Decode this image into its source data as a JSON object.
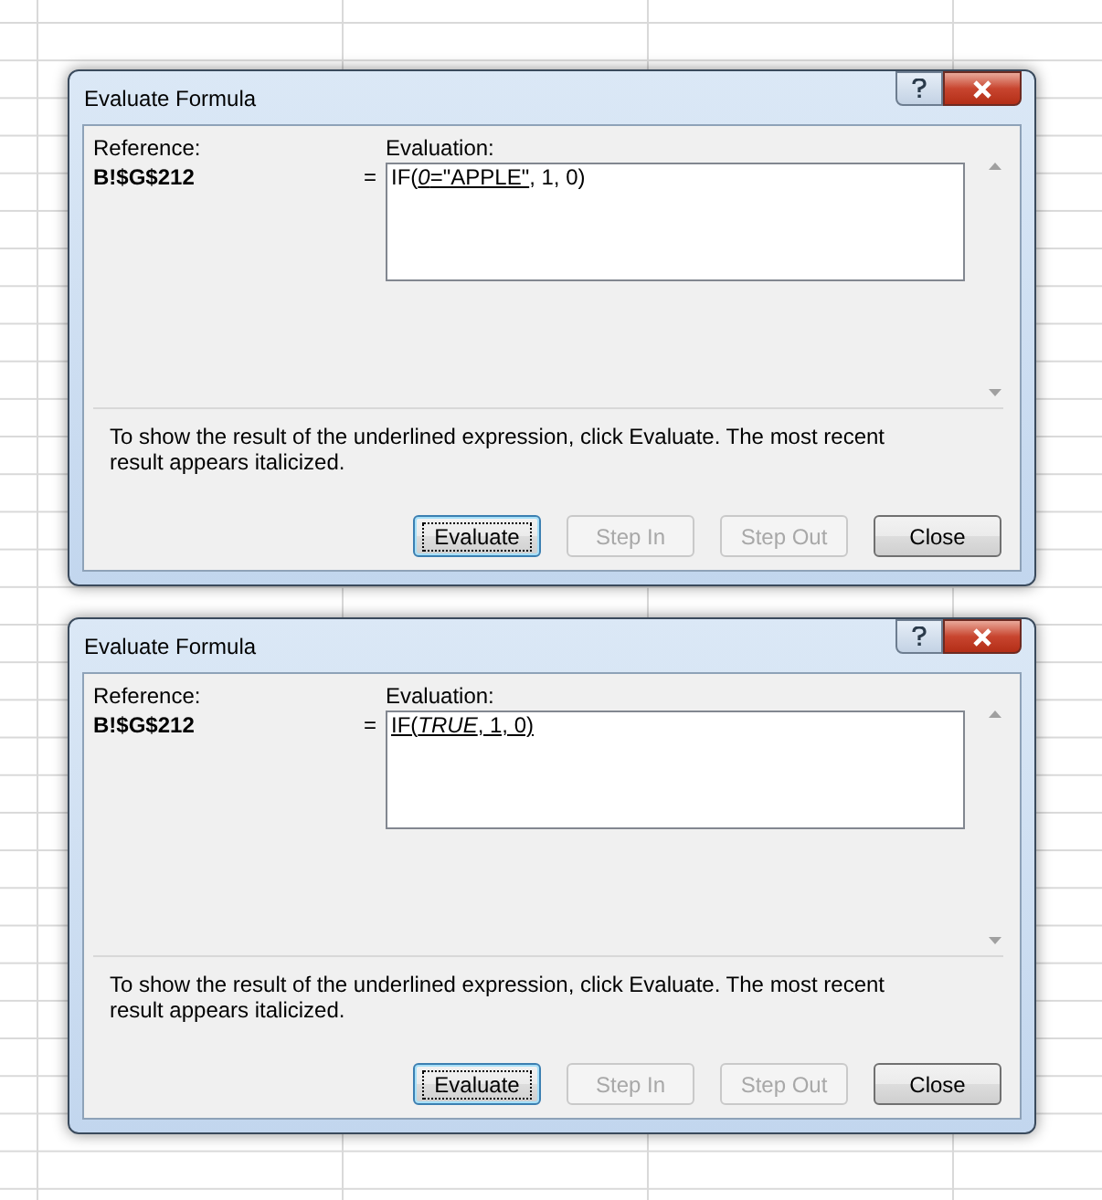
{
  "dialogs": [
    {
      "title": "Evaluate Formula",
      "reference_label": "Reference:",
      "reference": "B!$G$212",
      "equals": "=",
      "evaluation_label": "Evaluation:",
      "formula": [
        {
          "text": "IF(",
          "underlined": false
        },
        {
          "text": "*0*=\"APPLE\"",
          "underlined": true
        },
        {
          "text": ", 1, 0)",
          "underlined": false
        }
      ],
      "instructions": "To show the result of the underlined expression, click Evaluate.  The most recent result appears italicized.",
      "buttons": [
        {
          "label": "Evaluate",
          "disabled": false,
          "focused": true
        },
        {
          "label": "Step In",
          "disabled": true,
          "focused": false
        },
        {
          "label": "Step Out",
          "disabled": true,
          "focused": false
        },
        {
          "label": "Close",
          "disabled": false,
          "focused": false
        }
      ]
    },
    {
      "title": "Evaluate Formula",
      "reference_label": "Reference:",
      "reference": "B!$G$212",
      "equals": "=",
      "evaluation_label": "Evaluation:",
      "formula": [
        {
          "text": "IF(*TRUE*, 1, 0)",
          "underlined": true
        }
      ],
      "instructions": "To show the result of the underlined expression, click Evaluate.  The most recent result appears italicized.",
      "buttons": [
        {
          "label": "Evaluate",
          "disabled": false,
          "focused": true
        },
        {
          "label": "Step In",
          "disabled": true,
          "focused": false
        },
        {
          "label": "Step Out",
          "disabled": true,
          "focused": false
        },
        {
          "label": "Close",
          "disabled": false,
          "focused": false
        }
      ]
    }
  ]
}
